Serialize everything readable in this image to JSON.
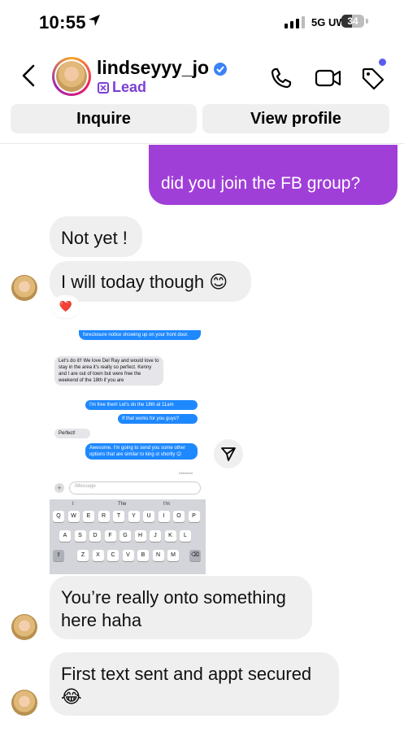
{
  "status": {
    "time": "10:55",
    "network": "5G UW",
    "battery": "34"
  },
  "header": {
    "username": "lindseyyy_jo",
    "label": "Lead",
    "inquire": "Inquire",
    "view_profile": "View profile"
  },
  "messages": {
    "out1": "did you join the FB group?",
    "in1": "Not yet !",
    "in2": "I will today though 😊",
    "reaction": "❤️",
    "in3_line1": "You’re really onto something",
    "in3_line2": "here haha",
    "in4_line1": "First text sent and appt secured",
    "in4_line2": "😂"
  },
  "screenshot": {
    "m1": "foreclosure notice showing up on your front door.",
    "m2": "Let's do it!! We love Del Ray and would love to stay in the area it's really so perfect. Kenny and I are out of town but were free the weekend of the 18th if you are",
    "m3": "I'm free then! Let's do the 18th at 11am",
    "m4": "If that works for you guys?",
    "m5": "Perfect!",
    "m6": "Awesome. I'm going to send you some other options that are similar to king st shortly 😊",
    "delivered": "Delivered",
    "placeholder": "iMessage",
    "sugg": [
      "I",
      "The",
      "I'm"
    ],
    "row1": [
      "Q",
      "W",
      "E",
      "R",
      "T",
      "Y",
      "U",
      "I",
      "O",
      "P"
    ],
    "row2": [
      "A",
      "S",
      "D",
      "F",
      "G",
      "H",
      "J",
      "K",
      "L"
    ],
    "row3": [
      "Z",
      "X",
      "C",
      "V",
      "B",
      "N",
      "M"
    ]
  }
}
